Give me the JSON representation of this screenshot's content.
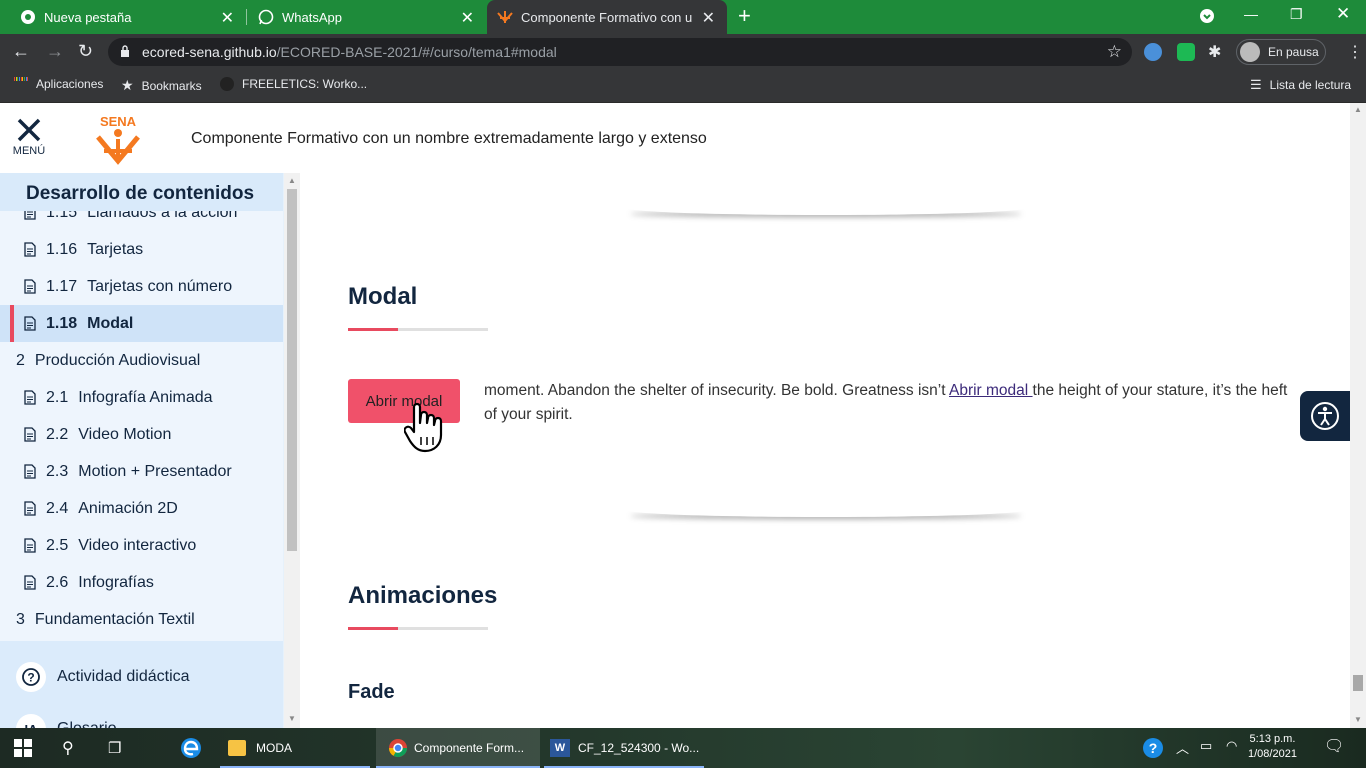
{
  "browser": {
    "tabs": [
      {
        "title": "Nueva pestaña",
        "icon": "chrome-icon"
      },
      {
        "title": "WhatsApp",
        "icon": "whatsapp-icon"
      },
      {
        "title": "Componente Formativo con un n",
        "icon": "sena-icon",
        "active": true
      }
    ],
    "url_host": "ecored-sena.github.io",
    "url_path": "/ECORED-BASE-2021/#/curso/tema1#modal",
    "profile_label": "En pausa",
    "bookmarks": [
      "Aplicaciones",
      "Bookmarks",
      "FREELETICS: Worko..."
    ],
    "reading_list": "Lista de lectura"
  },
  "header": {
    "menu_label": "MENÚ",
    "logo_text": "SENA",
    "course_title": "Componente Formativo con un nombre extremadamente largo y extenso"
  },
  "sidebar": {
    "heading": "Desarrollo de contenidos",
    "items": [
      {
        "num": "1.15",
        "label": "Llamados a la acción"
      },
      {
        "num": "1.16",
        "label": "Tarjetas"
      },
      {
        "num": "1.17",
        "label": "Tarjetas con número"
      },
      {
        "num": "1.18",
        "label": "Modal",
        "selected": true
      },
      {
        "num": "2",
        "label": "Producción Audiovisual",
        "top": true
      },
      {
        "num": "2.1",
        "label": "Infografía Animada"
      },
      {
        "num": "2.2",
        "label": "Video Motion"
      },
      {
        "num": "2.3",
        "label": "Motion + Presentador"
      },
      {
        "num": "2.4",
        "label": "Animación 2D"
      },
      {
        "num": "2.5",
        "label": "Video interactivo"
      },
      {
        "num": "2.6",
        "label": "Infografías"
      },
      {
        "num": "3",
        "label": "Fundamentación Textil",
        "top": true
      }
    ],
    "tools": [
      {
        "icon_text": "?",
        "label": "Actividad didáctica"
      },
      {
        "icon_text": "IA",
        "label": "Glosario"
      }
    ]
  },
  "content": {
    "section_modal": "Modal",
    "button_label": "Abrir modal",
    "para_before": "moment. Abandon the shelter of insecurity. Be bold. Greatness isn’t ",
    "para_link": "Abrir modal ",
    "para_after": "the height of your stature, it’s the heft of your spirit.",
    "section_anim": "Animaciones",
    "sub_fade": "Fade"
  },
  "taskbar": {
    "items": [
      "MODA",
      "Componente Form...",
      "CF_12_524300 - Wo..."
    ],
    "time": "5:13 p.m.",
    "date": "1/08/2021"
  },
  "colors": {
    "tab_bar": "#1e8b3a",
    "accent": "#e84a5f",
    "button": "#f0516a",
    "navy": "#12263f",
    "sena_orange": "#f47920"
  }
}
